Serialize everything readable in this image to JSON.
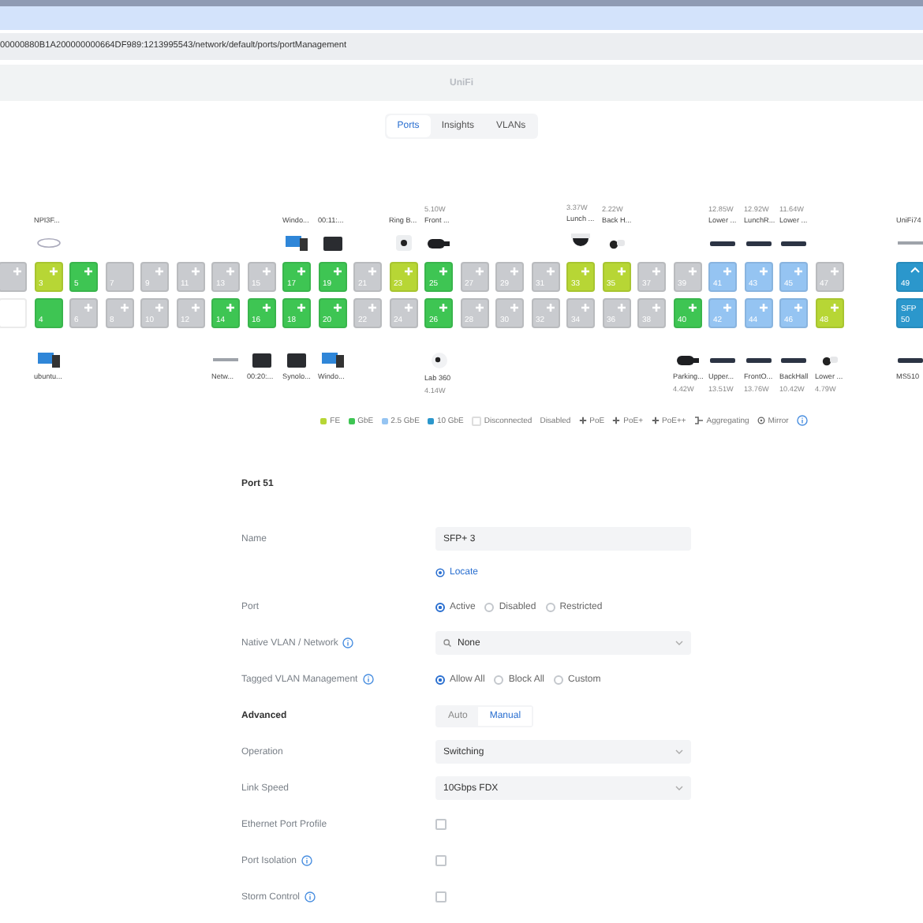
{
  "browser": {
    "url": "00000880B1A200000000664DF989:1213995543/network/default/ports/portManagement"
  },
  "app_title": "UniFi",
  "tabs": [
    {
      "label": "Ports",
      "selected": true
    },
    {
      "label": "Insights",
      "selected": false
    },
    {
      "label": "VLANs",
      "selected": false
    }
  ],
  "ports": [
    {
      "color": "#c9cbcf",
      "poe": true
    },
    {
      "color": "#ffffff",
      "poe": false
    },
    {
      "number": "3",
      "color": "#b7d635",
      "poe": true,
      "device": {
        "name": "NPI3F...",
        "kind": "router"
      }
    },
    {
      "number": "4",
      "color": "#3ec553",
      "poe": false,
      "device": {
        "name": "ubuntu...",
        "kind": "pc"
      }
    },
    {
      "number": "5",
      "color": "#3ec553",
      "poe": true
    },
    {
      "number": "6",
      "color": "#c9cbcf",
      "poe": true
    },
    {
      "number": "7",
      "color": "#c9cbcf",
      "poe": false
    },
    {
      "number": "8",
      "color": "#c9cbcf",
      "poe": true
    },
    {
      "number": "9",
      "color": "#c9cbcf",
      "poe": true
    },
    {
      "number": "10",
      "color": "#c9cbcf",
      "poe": true
    },
    {
      "number": "11",
      "color": "#c9cbcf",
      "poe": true
    },
    {
      "number": "12",
      "color": "#c9cbcf",
      "poe": true
    },
    {
      "number": "13",
      "color": "#c9cbcf",
      "poe": true
    },
    {
      "number": "14",
      "color": "#3ec553",
      "poe": true,
      "device": {
        "name": "Netw...",
        "kind": "network"
      }
    },
    {
      "number": "15",
      "color": "#c9cbcf",
      "poe": true
    },
    {
      "number": "16",
      "color": "#3ec553",
      "poe": true,
      "device": {
        "name": "00:20:...",
        "kind": "box"
      }
    },
    {
      "number": "17",
      "color": "#3ec553",
      "poe": true,
      "device": {
        "name": "Windo...",
        "kind": "pc"
      }
    },
    {
      "number": "18",
      "color": "#3ec553",
      "poe": true,
      "device": {
        "name": "Synolo...",
        "kind": "box"
      }
    },
    {
      "number": "19",
      "color": "#3ec553",
      "poe": true,
      "device": {
        "name": "00:11:...",
        "kind": "box"
      }
    },
    {
      "number": "20",
      "color": "#3ec553",
      "poe": true,
      "device": {
        "name": "Windo...",
        "kind": "pc"
      }
    },
    {
      "number": "21",
      "color": "#c9cbcf",
      "poe": true
    },
    {
      "number": "22",
      "color": "#c9cbcf",
      "poe": true
    },
    {
      "number": "23",
      "color": "#b7d635",
      "poe": true,
      "device": {
        "name": "Ring B...",
        "kind": "doorbell"
      }
    },
    {
      "number": "24",
      "color": "#c9cbcf",
      "poe": true
    },
    {
      "number": "25",
      "color": "#3ec553",
      "poe": true,
      "device": {
        "name": "Front ...",
        "power": "5.10W",
        "kind": "bullet"
      }
    },
    {
      "number": "26",
      "color": "#3ec553",
      "poe": true,
      "device": {
        "name": "Lab 360",
        "power": "4.14W",
        "kind": "cam360"
      }
    },
    {
      "number": "27",
      "color": "#c9cbcf",
      "poe": true
    },
    {
      "number": "28",
      "color": "#c9cbcf",
      "poe": true
    },
    {
      "number": "29",
      "color": "#c9cbcf",
      "poe": true
    },
    {
      "number": "30",
      "color": "#c9cbcf",
      "poe": true
    },
    {
      "number": "31",
      "color": "#c9cbcf",
      "poe": true
    },
    {
      "number": "32",
      "color": "#c9cbcf",
      "poe": true
    },
    {
      "number": "33",
      "color": "#b7d635",
      "poe": true,
      "device": {
        "name": "Lunch ...",
        "power": "3.37W",
        "kind": "dome"
      }
    },
    {
      "number": "34",
      "color": "#c9cbcf",
      "poe": true
    },
    {
      "number": "35",
      "color": "#b7d635",
      "poe": true,
      "device": {
        "name": "Back H...",
        "power": "2.22W",
        "kind": "smallcam"
      }
    },
    {
      "number": "36",
      "color": "#c9cbcf",
      "poe": true
    },
    {
      "number": "37",
      "color": "#c9cbcf",
      "poe": true
    },
    {
      "number": "38",
      "color": "#c9cbcf",
      "poe": true
    },
    {
      "number": "39",
      "color": "#c9cbcf",
      "poe": true
    },
    {
      "number": "40",
      "color": "#3ec553",
      "poe": true,
      "device": {
        "name": "Parking...",
        "power": "4.42W",
        "kind": "bullet"
      }
    },
    {
      "number": "41",
      "color": "#95c4f2",
      "poe": true,
      "device": {
        "name": "Lower ...",
        "power": "12.85W",
        "kind": "ap"
      }
    },
    {
      "number": "42",
      "color": "#95c4f2",
      "poe": true,
      "device": {
        "name": "Upper...",
        "power": "13.51W",
        "kind": "ap"
      }
    },
    {
      "number": "43",
      "color": "#95c4f2",
      "poe": true,
      "device": {
        "name": "LunchR...",
        "power": "12.92W",
        "kind": "ap"
      }
    },
    {
      "number": "44",
      "color": "#95c4f2",
      "poe": true,
      "device": {
        "name": "FrontO...",
        "power": "13.76W",
        "kind": "ap"
      }
    },
    {
      "number": "45",
      "color": "#95c4f2",
      "poe": true,
      "device": {
        "name": "Lower ...",
        "power": "11.64W",
        "kind": "ap"
      }
    },
    {
      "number": "46",
      "color": "#95c4f2",
      "poe": true,
      "device": {
        "name": "BackHall",
        "power": "10.42W",
        "kind": "ap"
      }
    },
    {
      "number": "47",
      "color": "#c9cbcf",
      "poe": true
    },
    {
      "number": "48",
      "color": "#b7d635",
      "poe": true,
      "device": {
        "name": "Lower ...",
        "power": "4.79W",
        "kind": "smallcam"
      }
    },
    {
      "number": "49",
      "color": "#2b97cc",
      "poe": false,
      "uplink": true,
      "device": {
        "name": "UniFi74",
        "kind": "network"
      }
    },
    {
      "number": "50",
      "color": "#2b97cc",
      "poe": false,
      "label": "SFP",
      "device": {
        "name": "MS510",
        "kind": "ap"
      }
    }
  ],
  "legend": [
    {
      "kind": "speed",
      "label": "FE",
      "color": "#b7d635"
    },
    {
      "kind": "speed",
      "label": "GbE",
      "color": "#3ec553"
    },
    {
      "kind": "speed",
      "label": "2.5 GbE",
      "color": "#95c4f2"
    },
    {
      "kind": "speed",
      "label": "10 GbE",
      "color": "#2b97cc"
    },
    {
      "kind": "disconnected",
      "label": "Disconnected"
    },
    {
      "kind": "disabled",
      "label": "Disabled"
    },
    {
      "kind": "poe",
      "label": "PoE"
    },
    {
      "kind": "poe",
      "label": "PoE+"
    },
    {
      "kind": "poe",
      "label": "PoE++"
    },
    {
      "kind": "aggregating",
      "label": "Aggregating"
    },
    {
      "kind": "mirror",
      "label": "Mirror"
    }
  ],
  "port_settings": {
    "title": "Port 51",
    "rows": [
      {
        "kind": "text",
        "label": "Name",
        "value": "SFP+ 3"
      },
      {
        "kind": "link",
        "text": "Locate"
      },
      {
        "kind": "radio",
        "label": "Port",
        "options": [
          {
            "label": "Active",
            "selected": true
          },
          {
            "label": "Disabled",
            "selected": false
          },
          {
            "label": "Restricted",
            "selected": false
          }
        ]
      },
      {
        "kind": "select",
        "label": "Native VLAN / Network",
        "info": true,
        "search": true,
        "value": "None"
      },
      {
        "kind": "radio",
        "label": "Tagged VLAN Management",
        "info": true,
        "options": [
          {
            "label": "Allow All",
            "selected": true
          },
          {
            "label": "Block All",
            "selected": false
          },
          {
            "label": "Custom",
            "selected": false
          }
        ]
      },
      {
        "kind": "segmented",
        "label": "Advanced",
        "options": [
          {
            "label": "Auto",
            "selected": false
          },
          {
            "label": "Manual",
            "selected": true
          }
        ]
      },
      {
        "kind": "select",
        "label": "Operation",
        "value": "Switching"
      },
      {
        "kind": "select",
        "label": "Link Speed",
        "value": "10Gbps FDX"
      },
      {
        "kind": "checkbox",
        "label": "Ethernet Port Profile",
        "checked": false
      },
      {
        "kind": "checkbox",
        "label": "Port Isolation",
        "info": true,
        "checked": false
      },
      {
        "kind": "checkbox",
        "label": "Storm Control",
        "info": true,
        "checked": false
      }
    ]
  }
}
